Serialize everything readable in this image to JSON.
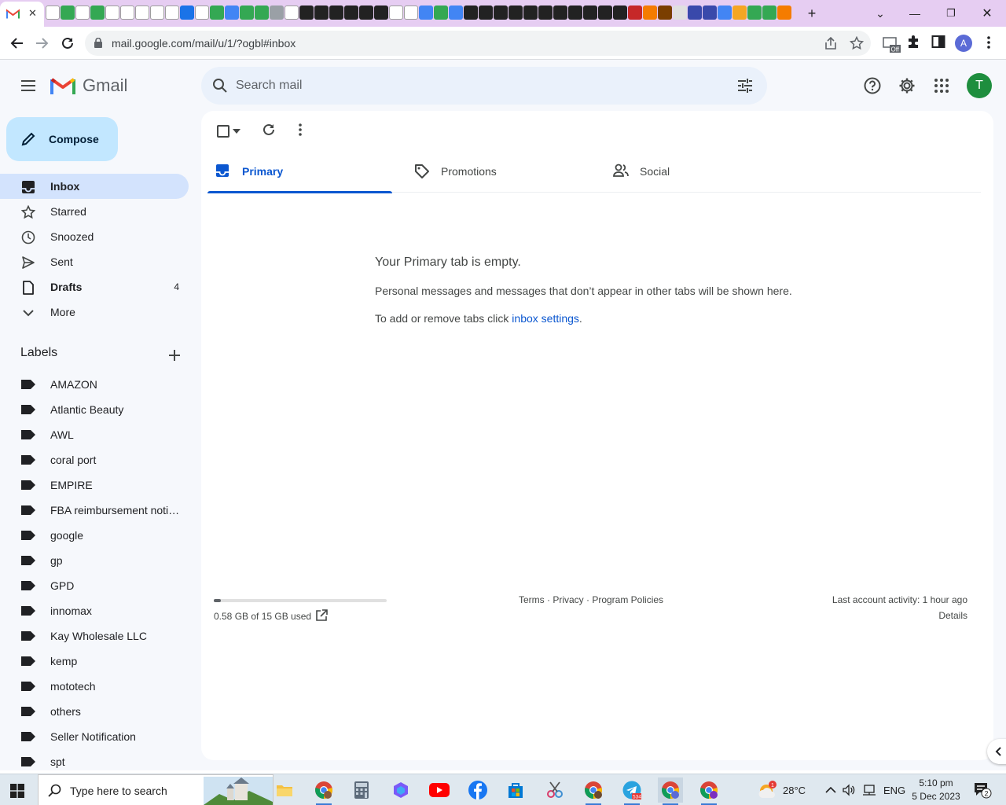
{
  "browser": {
    "url": "mail.google.com/mail/u/1/?ogbl#inbox",
    "profile_initial": "A",
    "extension_badge": "Off"
  },
  "gmail": {
    "logo_text": "Gmail",
    "search_placeholder": "Search mail",
    "account_initial": "T",
    "compose_label": "Compose",
    "nav": [
      {
        "label": "Inbox",
        "count": "",
        "icon": "inbox-icon"
      },
      {
        "label": "Starred",
        "count": "",
        "icon": "star-icon"
      },
      {
        "label": "Snoozed",
        "count": "",
        "icon": "clock-icon"
      },
      {
        "label": "Sent",
        "count": "",
        "icon": "send-icon"
      },
      {
        "label": "Drafts",
        "count": "4",
        "icon": "draft-icon"
      },
      {
        "label": "More",
        "count": "",
        "icon": "chevron-down-icon"
      }
    ],
    "labels_title": "Labels",
    "labels": [
      "AMAZON",
      "Atlantic Beauty",
      "AWL",
      "coral port",
      "EMPIRE",
      "FBA reimbursement notifications",
      "google",
      "gp",
      "GPD",
      "innomax",
      "Kay Wholesale LLC",
      "kemp",
      "mototech",
      "others",
      "Seller Notification",
      "spt"
    ],
    "tabs": [
      {
        "label": "Primary",
        "icon": "inbox-icon"
      },
      {
        "label": "Promotions",
        "icon": "tag-icon"
      },
      {
        "label": "Social",
        "icon": "people-icon"
      }
    ],
    "empty_title": "Your Primary tab is empty.",
    "empty_message": "Personal messages and messages that don’t appear in other tabs will be shown here.",
    "empty_help_prefix": "To add or remove tabs click ",
    "empty_help_link": "inbox settings",
    "empty_help_suffix": ".",
    "storage": {
      "text": "0.58 GB of 15 GB used",
      "used_fraction": 0.039
    },
    "footer_links": "Terms · Privacy · Program Policies",
    "last_activity": "Last account activity: 1 hour ago",
    "details": "Details"
  },
  "taskbar": {
    "search_placeholder": "Type here to search",
    "telegram_badge": "534",
    "weather_badge": "1",
    "temperature": "28°C",
    "language": "ENG",
    "time": "5:10 pm",
    "date": "5 Dec 2023",
    "notification_count": "2"
  },
  "colors": {
    "tabbar": "#e6cdf2",
    "accent": "#0b57d0",
    "compose": "#c2e7ff",
    "active_nav": "#d3e3fd",
    "avatar": "#1e8e3e"
  }
}
